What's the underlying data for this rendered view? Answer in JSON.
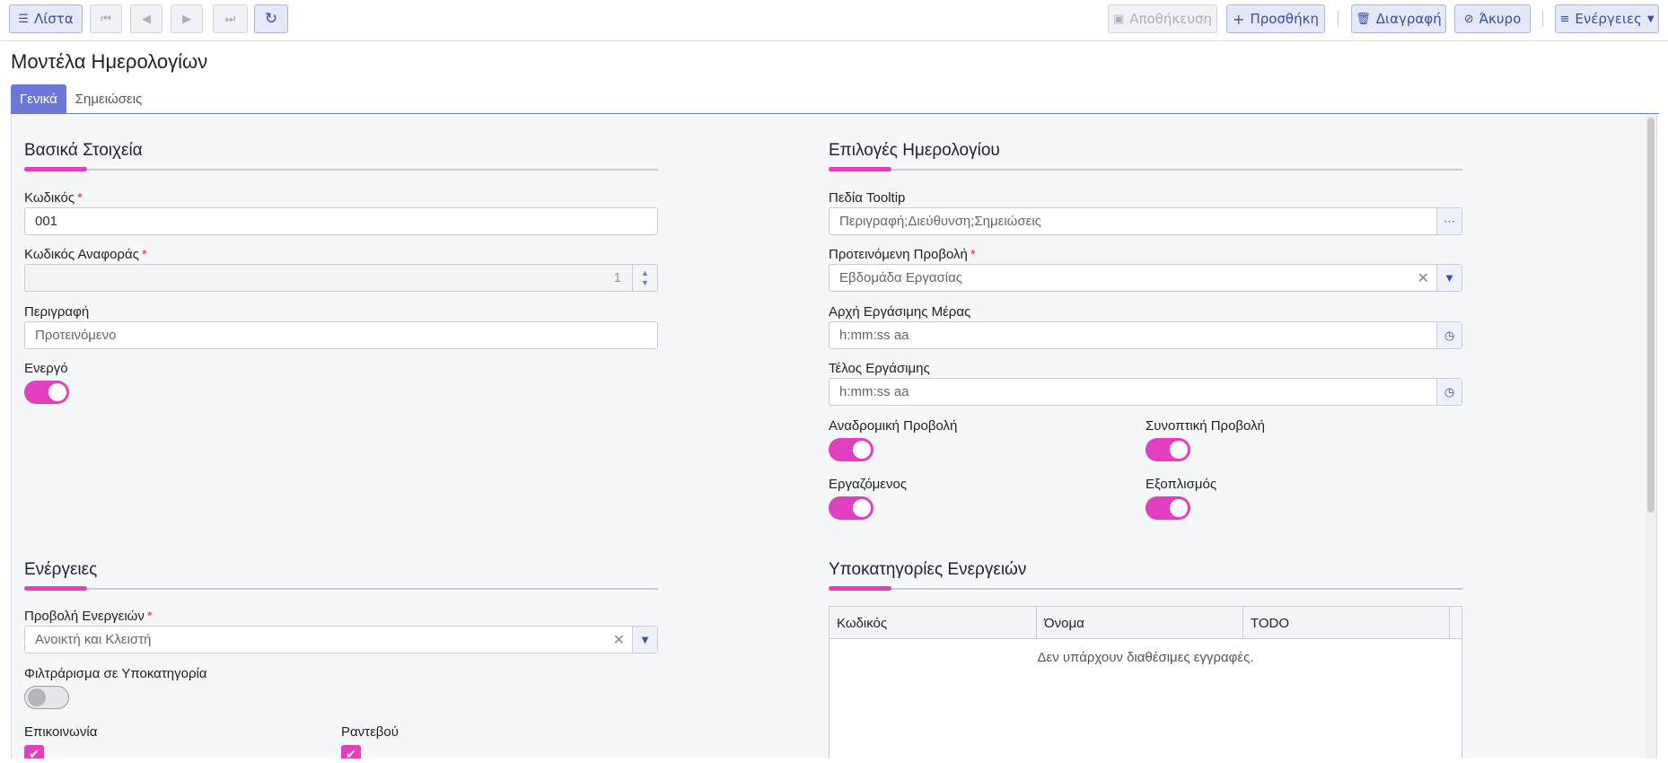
{
  "toolbar": {
    "list_label": "Λίστα",
    "save_label": "Αποθήκευση",
    "add_label": "Προσθήκη",
    "delete_label": "Διαγραφή",
    "cancel_label": "Άκυρο",
    "actions_label": "Ενέργειες",
    "icons": {
      "list": "list-icon",
      "first": "first-page-icon",
      "prev": "prev-icon",
      "next": "next-icon",
      "last": "last-page-icon",
      "refresh": "refresh-icon",
      "save": "save-icon",
      "add": "plus-icon",
      "delete": "trash-icon",
      "cancel": "ban-icon",
      "actions": "menu-icon"
    }
  },
  "page": {
    "title": "Μοντέλα Ημερολογίων",
    "tabs": [
      {
        "label": "Γενικά",
        "active": true
      },
      {
        "label": "Σημειώσεις",
        "active": false
      }
    ]
  },
  "basic": {
    "title": "Βασικά Στοιχεία",
    "code_label": "Κωδικός",
    "code_value": "001",
    "ref_label": "Κωδικός Αναφοράς",
    "ref_value": "1",
    "desc_label": "Περιγραφή",
    "desc_value": "Προτεινόμενο",
    "active_label": "Ενεργό",
    "active_on": true
  },
  "calendar": {
    "title": "Επιλογές Ημερολογίου",
    "tooltip_label": "Πεδία Tooltip",
    "tooltip_value": "Περιγραφή;Διεύθυνση;Σημειώσεις",
    "view_label": "Προτεινόμενη Προβολή",
    "view_value": "Εβδομάδα Εργασίας",
    "start_label": "Αρχή Εργάσιμης Μέρας",
    "start_placeholder": "h:mm:ss aa",
    "end_label": "Τέλος Εργάσιμης",
    "end_placeholder": "h:mm:ss aa",
    "retro_label": "Αναδρομική Προβολή",
    "summary_label": "Συνοπτική Προβολή",
    "employee_label": "Εργαζόμενος",
    "equipment_label": "Εξοπλισμός"
  },
  "actions": {
    "title": "Ενέργειες",
    "view_label": "Προβολή Ενεργειών",
    "view_value": "Ανοικτή και Κλειστή",
    "filter_label": "Φιλτράρισμα σε Υποκατηγορία",
    "filter_on": false,
    "comm_label": "Επικοινωνία",
    "appt_label": "Ραντεβού"
  },
  "subcat": {
    "title": "Υποκατηγορίες Ενεργειών",
    "columns": [
      "Κωδικός",
      "Όνομα",
      "TODO"
    ],
    "empty": "Δεν υπάρχουν διαθέσιμες εγγραφές."
  },
  "colors": {
    "accent": "#e040c0",
    "primary": "#6b78d8",
    "button_bg": "#e4e8f8"
  }
}
